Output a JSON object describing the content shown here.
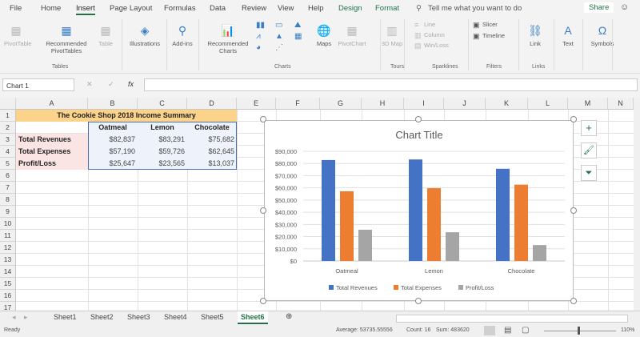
{
  "menu": {
    "tabs": [
      "File",
      "Home",
      "Insert",
      "Page Layout",
      "Formulas",
      "Data",
      "Review",
      "View",
      "Help",
      "Design",
      "Format"
    ],
    "active": "Insert",
    "search_placeholder": "Tell me what you want to do",
    "share": "Share"
  },
  "ribbon": {
    "items": [
      "PivotTable",
      "Recommended PivotTables",
      "Table",
      "Illustrations",
      "Add-ins",
      "Recommended Charts",
      "Maps",
      "PivotChart",
      "3D Map",
      "Line",
      "Column",
      "Win/Loss",
      "Slicer",
      "Timeline",
      "Link",
      "Text",
      "Symbols"
    ],
    "groups": [
      "Tables",
      "Charts",
      "Tours",
      "Sparklines",
      "Filters",
      "Links"
    ]
  },
  "formula_bar": {
    "name_box": "Chart 1",
    "formula": "",
    "fx": "fx"
  },
  "columns": [
    "A",
    "B",
    "C",
    "D",
    "E",
    "F",
    "G",
    "H",
    "I",
    "J",
    "K",
    "L",
    "M",
    "N"
  ],
  "rows": [
    "1",
    "2",
    "3",
    "4",
    "5",
    "6",
    "7",
    "8",
    "9",
    "10",
    "11",
    "12",
    "13",
    "14",
    "15",
    "16",
    "17"
  ],
  "table": {
    "title": "The Cookie Shop 2018 Income Summary",
    "headers": [
      "Oatmeal",
      "Lemon",
      "Chocolate"
    ],
    "rows": [
      {
        "label": "Total Revenues",
        "values": [
          "$82,837",
          "$83,291",
          "$75,682"
        ]
      },
      {
        "label": "Total Expenses",
        "values": [
          "$57,190",
          "$59,726",
          "$62,645"
        ]
      },
      {
        "label": "Profit/Loss",
        "values": [
          "$25,647",
          "$23,565",
          "$13,037"
        ]
      }
    ]
  },
  "chart_data": {
    "type": "bar",
    "title": "Chart Title",
    "categories": [
      "Oatmeal",
      "Lemon",
      "Chocolate"
    ],
    "series": [
      {
        "name": "Total Revenues",
        "values": [
          82837,
          83291,
          75682
        ],
        "color": "#4472c4"
      },
      {
        "name": "Total Expenses",
        "values": [
          57190,
          59726,
          62645
        ],
        "color": "#ed7d31"
      },
      {
        "name": "Profit/Loss",
        "values": [
          25647,
          23565,
          13037
        ],
        "color": "#a5a5a5"
      }
    ],
    "ylim": [
      0,
      90000
    ],
    "yticks": [
      "$0",
      "$10,000",
      "$20,000",
      "$30,000",
      "$40,000",
      "$50,000",
      "$60,000",
      "$70,000",
      "$80,000",
      "$90,000"
    ],
    "grid": true,
    "legend": "bottom"
  },
  "sheets": {
    "tabs": [
      "Sheet1",
      "Sheet2",
      "Sheet3",
      "Sheet4",
      "Sheet5",
      "Sheet6"
    ],
    "active": "Sheet6"
  },
  "status": {
    "mode": "Ready",
    "average": "Average: 53735.55556",
    "count": "Count: 16",
    "sum": "Sum: 483620",
    "zoom": "110%"
  }
}
